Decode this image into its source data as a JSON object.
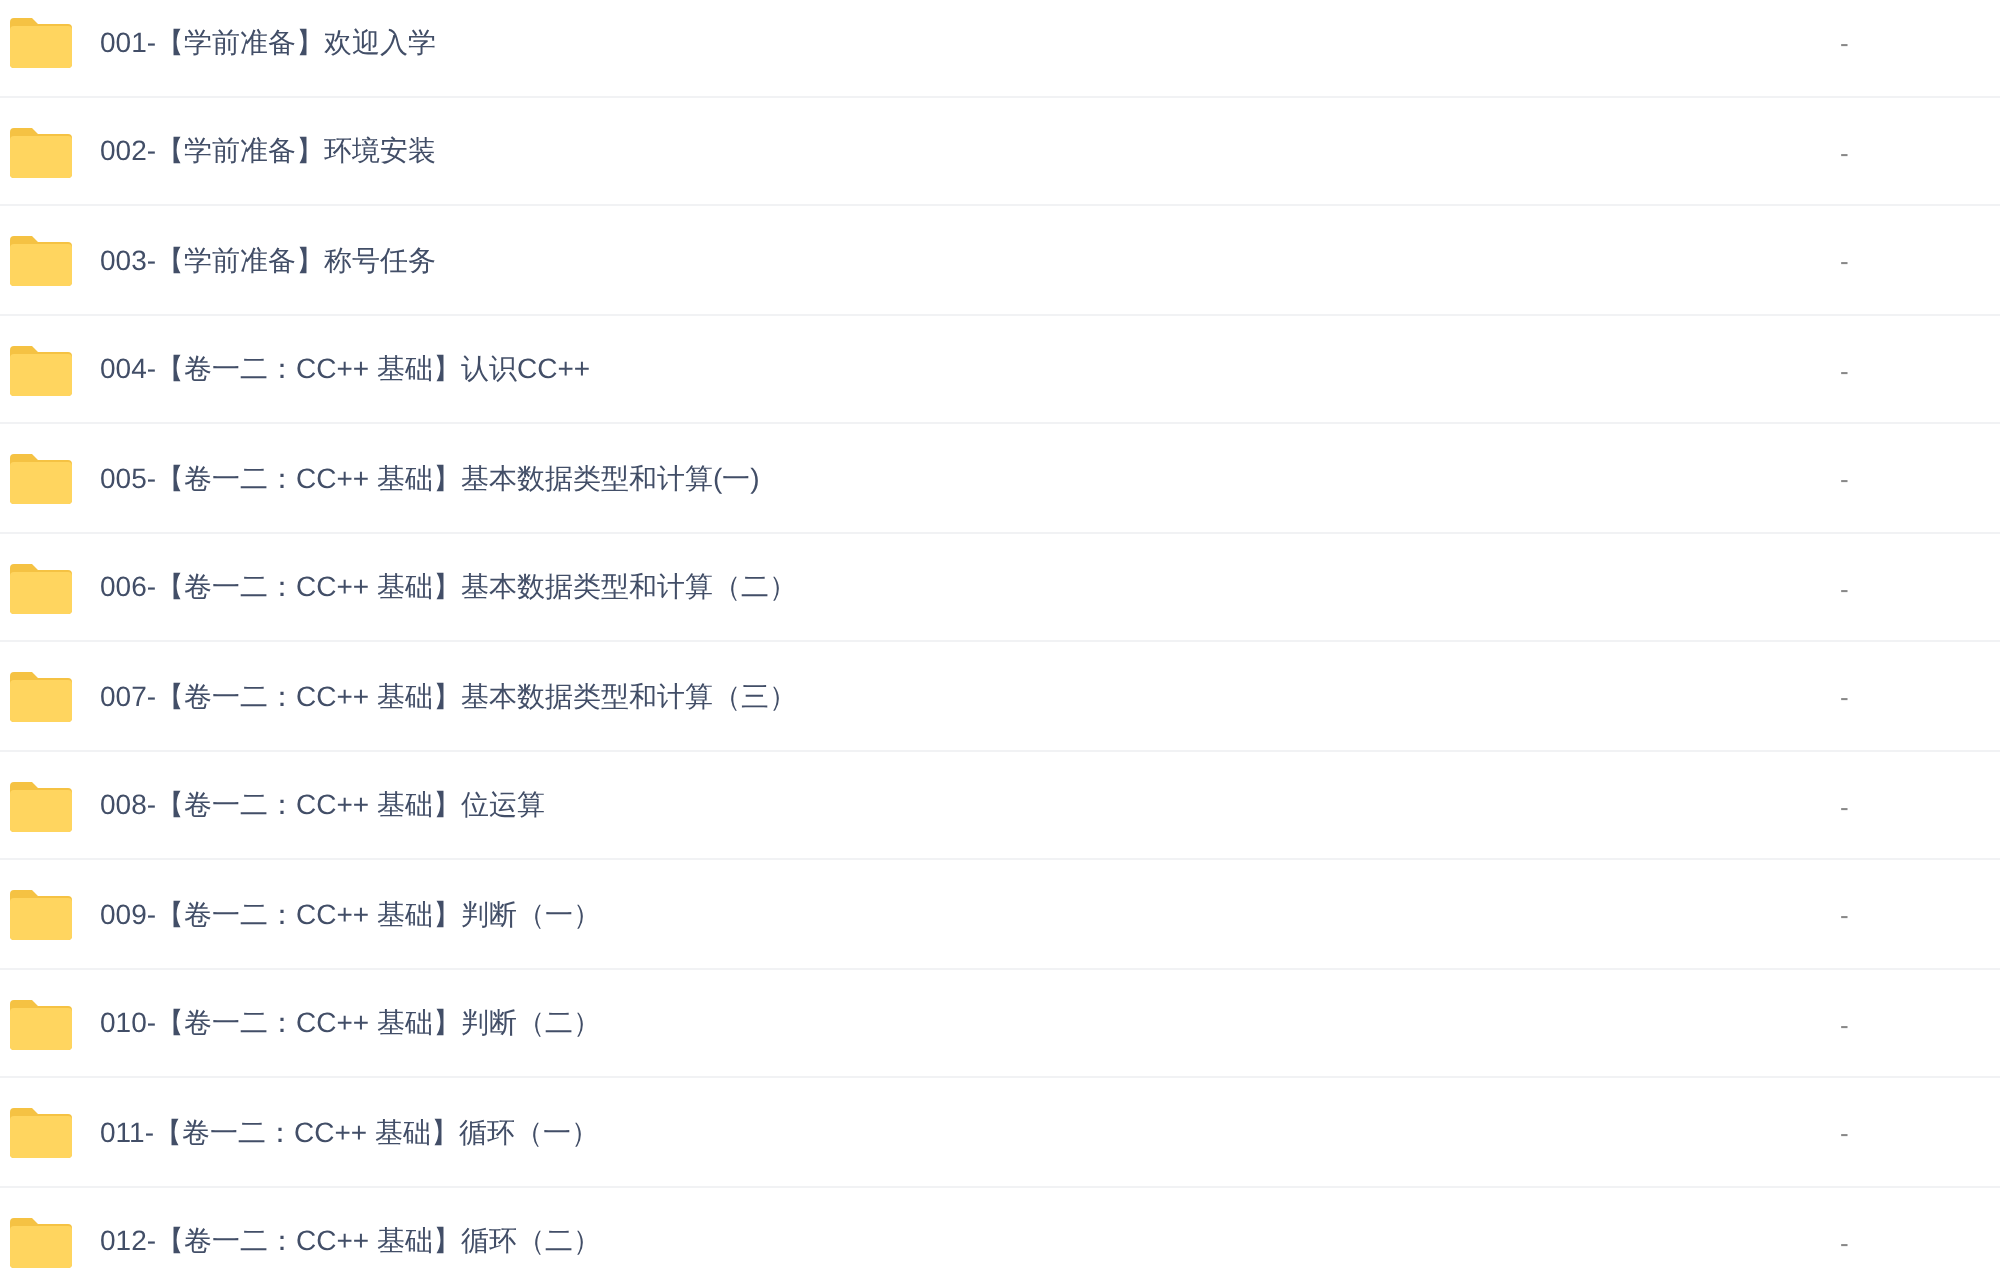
{
  "files": [
    {
      "name": "001-【学前准备】欢迎入学",
      "column_2": "-"
    },
    {
      "name": "002-【学前准备】环境安装",
      "column_2": "-"
    },
    {
      "name": "003-【学前准备】称号任务",
      "column_2": "-"
    },
    {
      "name": "004-【卷一二：CC++ 基础】认识CC++",
      "column_2": "-"
    },
    {
      "name": "005-【卷一二：CC++ 基础】基本数据类型和计算(一)",
      "column_2": "-"
    },
    {
      "name": "006-【卷一二：CC++ 基础】基本数据类型和计算（二）",
      "column_2": "-"
    },
    {
      "name": "007-【卷一二：CC++ 基础】基本数据类型和计算（三）",
      "column_2": "-"
    },
    {
      "name": "008-【卷一二：CC++ 基础】位运算",
      "column_2": "-"
    },
    {
      "name": "009-【卷一二：CC++ 基础】判断（一）",
      "column_2": "-"
    },
    {
      "name": "010-【卷一二：CC++ 基础】判断（二）",
      "column_2": "-"
    },
    {
      "name": "011-【卷一二：CC++ 基础】循环（一）",
      "column_2": "-"
    },
    {
      "name": "012-【卷一二：CC++ 基础】循环（二）",
      "column_2": "-"
    }
  ]
}
